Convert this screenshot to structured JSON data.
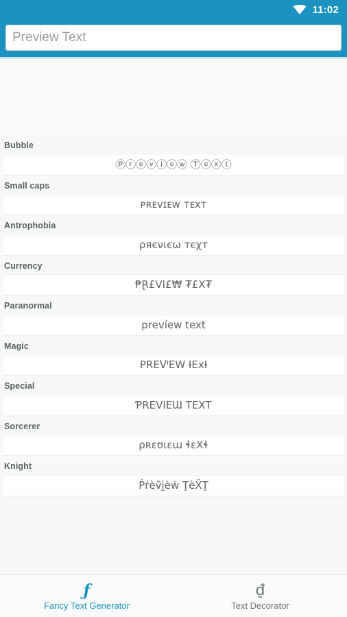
{
  "status_bar": {
    "wifi_icon": "wifi-icon",
    "time": "11:02",
    "background_color": "#1b92c0"
  },
  "header": {
    "input_value": "",
    "input_placeholder": "Preview Text",
    "background_color": "#1b92c0"
  },
  "styles": [
    {
      "label": "Bubble",
      "preview": "Ⓟⓡⓔⓥⓘⓔⓦ Ⓣⓔⓧⓣ"
    },
    {
      "label": "Small caps",
      "preview": "ᴘʀᴇᴠɪᴇᴡ ᴛᴇxᴛ"
    },
    {
      "label": "Antrophobia",
      "preview": "ρяєνιєω тєχт"
    },
    {
      "label": "Currency",
      "preview": "₱Ɽ£VI£₩ ₮£X₮"
    },
    {
      "label": "Paranormal",
      "preview": "prevíew text"
    },
    {
      "label": "Magic",
      "preview": "PREᐯᴵEW ƗExƗ"
    },
    {
      "label": "Special",
      "preview": "ƤREVIEƜ TEXT"
    },
    {
      "label": "Sorcerer",
      "preview": "ρʀɛʊɩɛɯ ɬɛXɬ"
    },
    {
      "label": "Knight",
      "preview": "Ṗṙèṽḭèẇ ṮèẌṮ"
    }
  ],
  "bottom_nav": {
    "tabs": [
      {
        "icon": "ƒ",
        "icon_name": "fancy-f-icon",
        "label": "Fancy Text Generator",
        "active": true,
        "color": "#1b92c0"
      },
      {
        "icon": "₫",
        "icon_name": "decorated-d-icon",
        "label": "Text Decorator",
        "active": false,
        "color": "#6d7275"
      }
    ]
  }
}
